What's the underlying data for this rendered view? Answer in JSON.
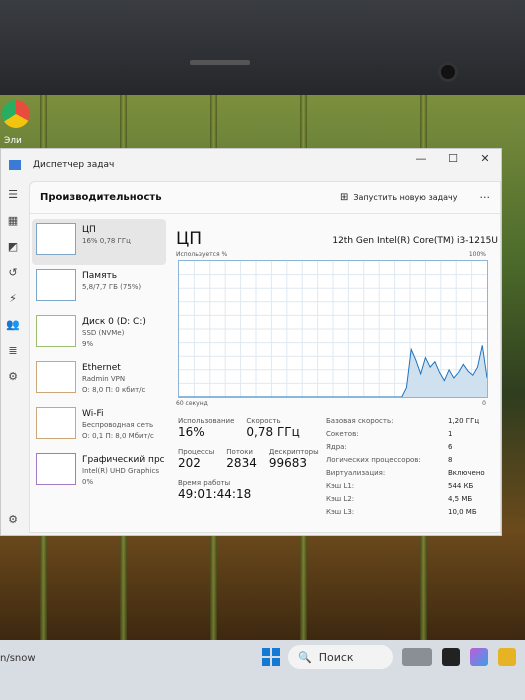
{
  "desktop": {
    "icon_label": "Эли"
  },
  "window": {
    "title": "Диспетчер задач",
    "controls": [
      "—",
      "☐",
      "✕"
    ]
  },
  "header": {
    "title": "Производительность",
    "run_task": "Запустить новую задачу",
    "more": "···"
  },
  "devices": [
    {
      "name": "ЦП",
      "sub1": "16% 0,78 ГГц",
      "sub2": "",
      "color": "#5b9bd5"
    },
    {
      "name": "Память",
      "sub1": "5,8/7,7 ГБ (75%)",
      "sub2": "",
      "color": "#5b9bd5"
    },
    {
      "name": "Диск 0 (D: C:)",
      "sub1": "SSD (NVMe)",
      "sub2": "9%",
      "color": "#7cb342"
    },
    {
      "name": "Ethernet",
      "sub1": "Radmin VPN",
      "sub2": "О: 8,0 П: 0 кбит/с",
      "color": "#c9a779"
    },
    {
      "name": "Wi-Fi",
      "sub1": "Беспроводная сеть",
      "sub2": "О: 0,1 П: 8,0 Мбит/с",
      "color": "#c9a779"
    },
    {
      "name": "Графический прс",
      "sub1": "Intel(R) UHD Graphics",
      "sub2": "0%",
      "color": "#a07cc0"
    }
  ],
  "cpu": {
    "title": "ЦП",
    "model": "12th Gen Intel(R) Core(TM) i3-1215U",
    "used_label": "Используется %",
    "max_label": "100%",
    "time_label": "60 секунд",
    "zero_label": "0",
    "usage_series": [
      0,
      0,
      0,
      0,
      0,
      0,
      0,
      0,
      0,
      0,
      0,
      0,
      0,
      0,
      0,
      0,
      0,
      0,
      0,
      0,
      0,
      0,
      0,
      0,
      0,
      0,
      0,
      0,
      0,
      0,
      0,
      0,
      0,
      0,
      0,
      0,
      0,
      0,
      0,
      0,
      0,
      0,
      0,
      0,
      0,
      0,
      0,
      0,
      7,
      35,
      27,
      17,
      29,
      22,
      26,
      18,
      12,
      20,
      14,
      18,
      24,
      19,
      16,
      22,
      38,
      14
    ]
  },
  "stats": {
    "usage_label": "Использование",
    "usage": "16%",
    "speed_label": "Скорость",
    "speed": "0,78 ГГц",
    "proc_label": "Процессы",
    "proc": "202",
    "threads_label": "Потоки",
    "threads": "2834",
    "handles_label": "Дескрипторы",
    "handles": "99683",
    "uptime_label": "Время работы",
    "uptime": "49:01:44:18"
  },
  "info": [
    {
      "k": "Базовая скорость:",
      "v": "1,20 ГГц"
    },
    {
      "k": "Сокетов:",
      "v": "1"
    },
    {
      "k": "Ядра:",
      "v": "6"
    },
    {
      "k": "Логических процессоров:",
      "v": "8"
    },
    {
      "k": "Виртуализация:",
      "v": "Включено"
    },
    {
      "k": "Кэш L1:",
      "v": "544 КБ"
    },
    {
      "k": "Кэш L2:",
      "v": "4,5 МБ"
    },
    {
      "k": "Кэш L3:",
      "v": "10,0 МБ"
    }
  ],
  "taskbar": {
    "left_text": "n/snow",
    "search": "Поиск"
  }
}
